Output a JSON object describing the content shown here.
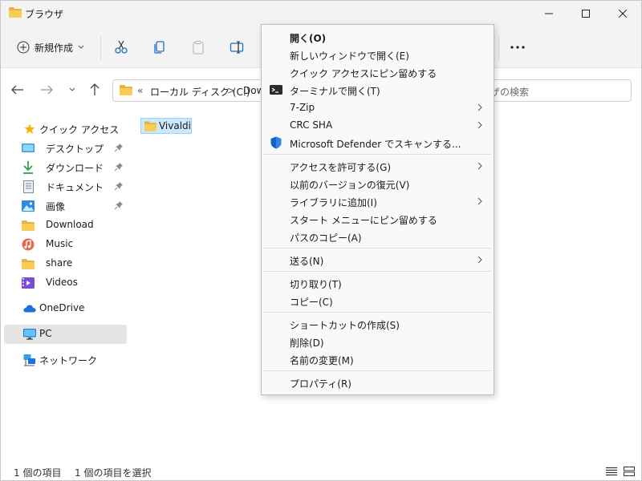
{
  "window": {
    "title": "ブラウザ"
  },
  "command_bar": {
    "new_label": "新規作成",
    "more_label": "…"
  },
  "address": {
    "chevrons": "«",
    "segment1": "ローカル ディスク (C:)",
    "separator": ">",
    "segment2": "Dow",
    "search_placeholder": "ザの検索"
  },
  "sidebar": {
    "quick_access": "クイック アクセス",
    "items": [
      {
        "label": "デスクトップ",
        "icon": "desktop-icon"
      },
      {
        "label": "ダウンロード",
        "icon": "download-icon"
      },
      {
        "label": "ドキュメント",
        "icon": "document-icon"
      },
      {
        "label": "画像",
        "icon": "pictures-icon"
      },
      {
        "label": "Download",
        "icon": "folder-icon"
      },
      {
        "label": "Music",
        "icon": "music-icon"
      },
      {
        "label": "share",
        "icon": "folder-icon"
      },
      {
        "label": "Videos",
        "icon": "videos-icon"
      }
    ],
    "onedrive": "OneDrive",
    "pc": "PC",
    "network": "ネットワーク"
  },
  "content": {
    "files": [
      {
        "name": "Vivaldi"
      }
    ]
  },
  "status": {
    "count": "1 個の項目",
    "selected": "1 個の項目を選択"
  },
  "context_menu": {
    "groups": [
      [
        {
          "label": "開く(O)",
          "bold": true
        },
        {
          "label": "新しいウィンドウで開く(E)"
        },
        {
          "label": "クイック アクセスにピン留めする"
        },
        {
          "label": "ターミナルで開く(T)",
          "icon": "terminal-icon"
        },
        {
          "label": "7-Zip",
          "submenu": true
        },
        {
          "label": "CRC SHA",
          "submenu": true
        },
        {
          "label": "Microsoft Defender でスキャンする...",
          "icon": "defender-shield-icon"
        }
      ],
      [
        {
          "label": "アクセスを許可する(G)",
          "submenu": true
        },
        {
          "label": "以前のバージョンの復元(V)"
        },
        {
          "label": "ライブラリに追加(I)",
          "submenu": true
        },
        {
          "label": "スタート メニューにピン留めする"
        },
        {
          "label": "パスのコピー(A)"
        }
      ],
      [
        {
          "label": "送る(N)",
          "submenu": true
        }
      ],
      [
        {
          "label": "切り取り(T)"
        },
        {
          "label": "コピー(C)"
        }
      ],
      [
        {
          "label": "ショートカットの作成(S)"
        },
        {
          "label": "削除(D)"
        },
        {
          "label": "名前の変更(M)"
        }
      ],
      [
        {
          "label": "プロパティ(R)"
        }
      ]
    ]
  },
  "colors": {
    "folder": "#f3c443",
    "accent": "#0067c0",
    "selection": "#cce8ff",
    "chrome": "#f3f3f3"
  }
}
